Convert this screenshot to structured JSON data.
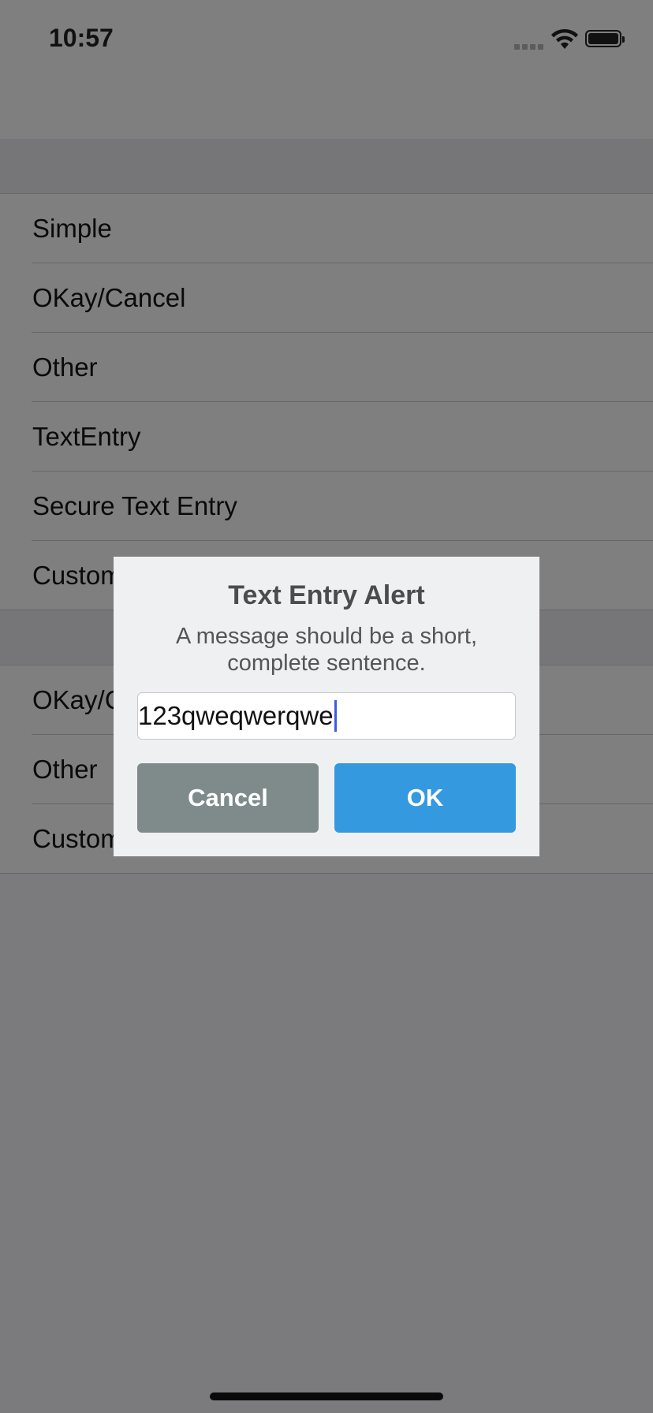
{
  "status_bar": {
    "time": "10:57",
    "icons": [
      "cellular-signal-icon",
      "wifi-icon",
      "battery-icon"
    ]
  },
  "list": {
    "section1": [
      {
        "label": "Simple"
      },
      {
        "label": "OKay/Cancel"
      },
      {
        "label": "Other"
      },
      {
        "label": "TextEntry"
      },
      {
        "label": "Secure Text Entry"
      },
      {
        "label": "Custom"
      }
    ],
    "section2": [
      {
        "label": "OKay/C"
      },
      {
        "label": "Other"
      },
      {
        "label": "Custom"
      }
    ]
  },
  "alert": {
    "title": "Text Entry Alert",
    "message": "A message should be a short, complete sentence.",
    "input_value": "123qweqwerqwe",
    "cancel_label": "Cancel",
    "ok_label": "OK",
    "colors": {
      "cancel": "#7f8b8b",
      "ok": "#3499de",
      "caret": "#3b5be0"
    }
  }
}
